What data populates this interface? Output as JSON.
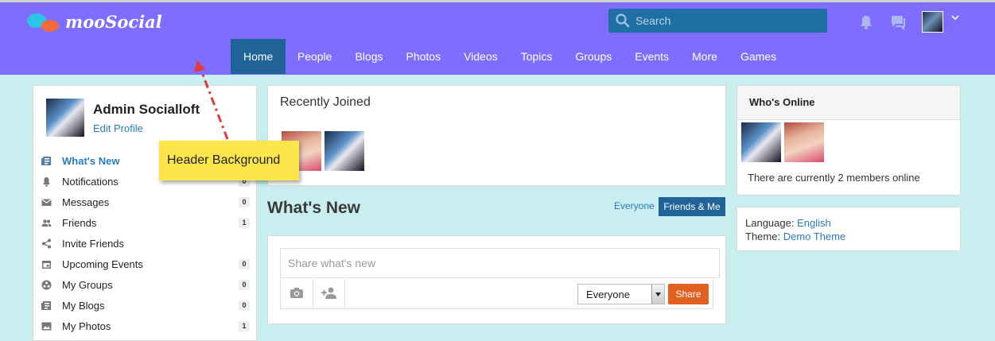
{
  "app": {
    "logo_text": "mooSocial"
  },
  "header": {
    "search": {
      "placeholder": "Search"
    },
    "icons": [
      "bell-icon",
      "chat-icon"
    ],
    "nav": [
      {
        "label": "Home",
        "active": true
      },
      {
        "label": "People"
      },
      {
        "label": "Blogs"
      },
      {
        "label": "Photos"
      },
      {
        "label": "Videos"
      },
      {
        "label": "Topics"
      },
      {
        "label": "Groups"
      },
      {
        "label": "Events"
      },
      {
        "label": "More"
      },
      {
        "label": "Games"
      }
    ]
  },
  "sidebar": {
    "user_name": "Admin Socialloft",
    "edit_profile": "Edit Profile",
    "items": [
      {
        "label": "What's New",
        "icon": "news-icon",
        "active": true
      },
      {
        "label": "Notifications",
        "icon": "bell-icon",
        "badge": "0"
      },
      {
        "label": "Messages",
        "icon": "envelope-icon",
        "badge": "0"
      },
      {
        "label": "Friends",
        "icon": "friends-icon",
        "badge": "1"
      },
      {
        "label": "Invite Friends",
        "icon": "share-icon"
      },
      {
        "label": "Upcoming Events",
        "icon": "calendar-icon",
        "badge": "0"
      },
      {
        "label": "My Groups",
        "icon": "groups-icon",
        "badge": "0"
      },
      {
        "label": "My Blogs",
        "icon": "blog-icon",
        "badge": "0"
      },
      {
        "label": "My Photos",
        "icon": "photo-icon",
        "badge": "1"
      }
    ]
  },
  "recently_joined": {
    "title": "Recently Joined"
  },
  "whats_new": {
    "title": "What's New",
    "filter_everyone": "Everyone",
    "filter_friends": "Friends & Me"
  },
  "share": {
    "placeholder": "Share what's new",
    "privacy": "Everyone",
    "button": "Share"
  },
  "online": {
    "title": "Who's Online",
    "text": "There are currently 2 members online"
  },
  "language": {
    "language_label": "Language:",
    "language_value": "English",
    "theme_label": "Theme:",
    "theme_value": "Demo Theme"
  },
  "annotation": {
    "note": "Header Background"
  },
  "colors": {
    "header_bg": "#7f6dff",
    "nav_active": "#1f6399",
    "page_bg": "#c8eef0",
    "link": "#2a7bbd",
    "share_button": "#e36120",
    "note_bg": "#fde64b",
    "arrow": "#e53935"
  }
}
